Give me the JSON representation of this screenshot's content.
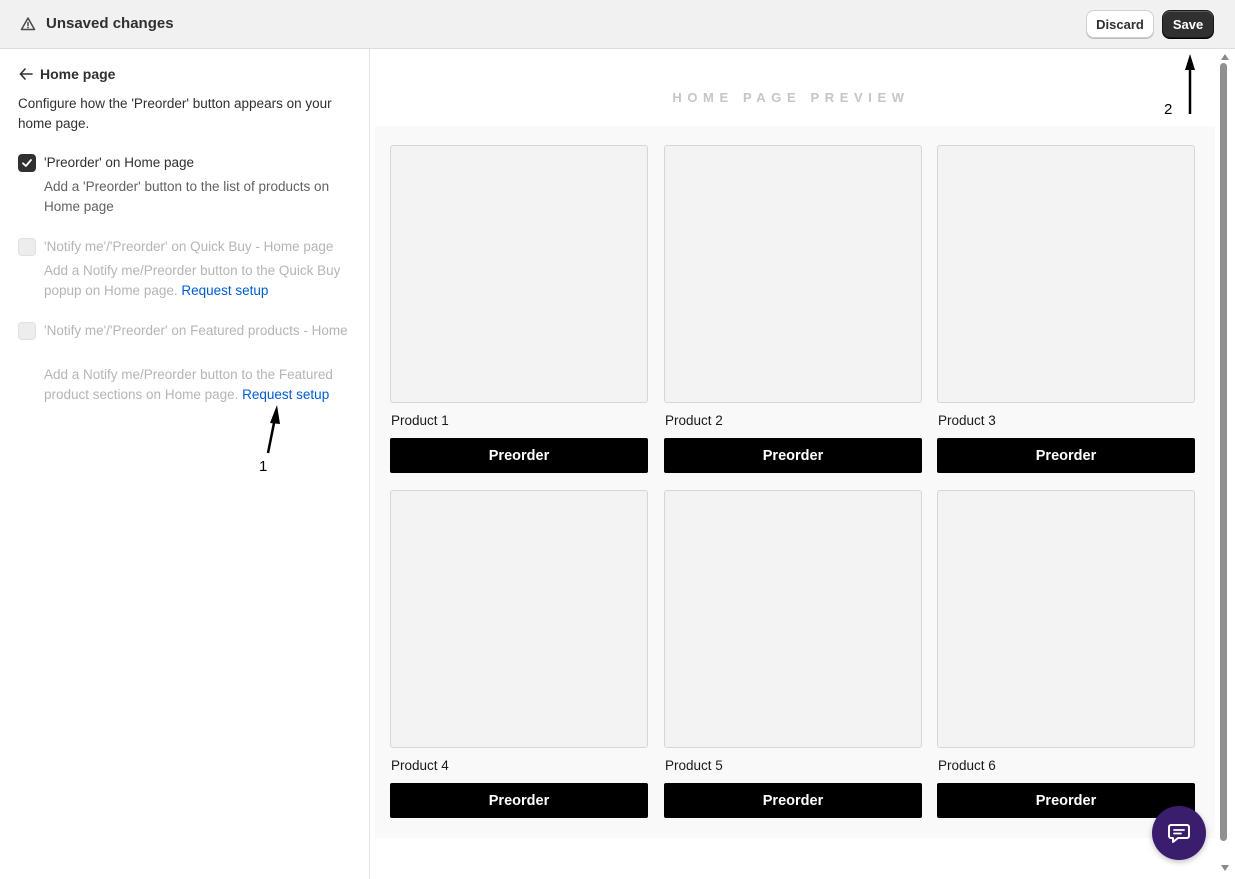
{
  "topbar": {
    "title": "Unsaved changes",
    "warning_icon": "warning-triangle-icon",
    "discard_label": "Discard",
    "save_label": "Save"
  },
  "left_panel": {
    "back_label": "Home page",
    "description": "Configure how the 'Preorder' button appears on your home page.",
    "options": [
      {
        "label": "'Preorder' on Home page",
        "hint": "Add a 'Preorder' button to the list of products on Home page",
        "checked": true,
        "enabled": true
      },
      {
        "label": "'Notify me'/'Preorder' on Quick Buy - Home page",
        "hint": "Add a Notify me/Preorder button to the Quick Buy popup on Home page.",
        "link": "Request setup",
        "checked": false,
        "enabled": false
      },
      {
        "label": "'Notify me'/'Preorder' on Featured products - Home",
        "hint": "Add a Notify me/Preorder button to the Featured product sections on Home page.",
        "link": "Request setup",
        "checked": false,
        "enabled": false
      }
    ]
  },
  "annotations": {
    "one": "1",
    "two": "2"
  },
  "preview": {
    "title": "HOME PAGE PREVIEW",
    "products": [
      {
        "name": "Product 1",
        "button": "Preorder"
      },
      {
        "name": "Product 2",
        "button": "Preorder"
      },
      {
        "name": "Product 3",
        "button": "Preorder"
      },
      {
        "name": "Product 4",
        "button": "Preorder"
      },
      {
        "name": "Product 5",
        "button": "Preorder"
      },
      {
        "name": "Product 6",
        "button": "Preorder"
      }
    ]
  },
  "colors": {
    "topbar_bg": "#f1f1f1",
    "save_bg": "#303030",
    "link": "#005bd3",
    "preorder_bg": "#000000",
    "chat_bg": "#3b1d6e"
  },
  "chat": {
    "icon": "chat-bubble-icon"
  }
}
